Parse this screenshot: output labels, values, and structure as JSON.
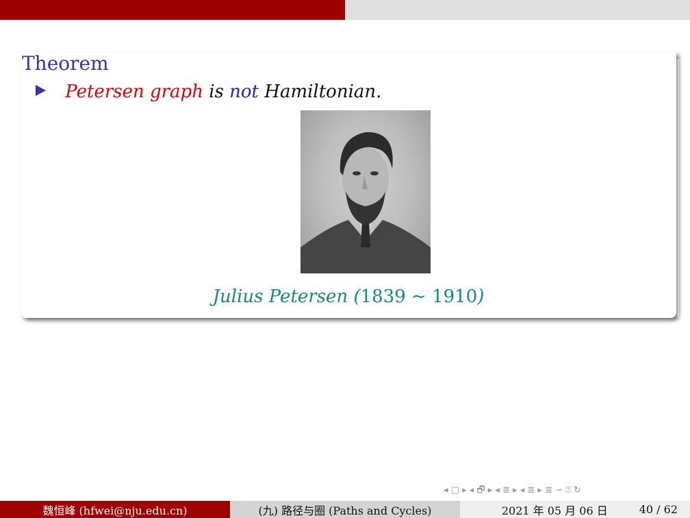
{
  "progress": {
    "fraction": 0.5
  },
  "theorem": {
    "title": "Theorem",
    "statement_parts": [
      "Petersen graph",
      " is ",
      "not",
      " Hamiltonian."
    ]
  },
  "figure": {
    "caption_name": "Julius Petersen (",
    "caption_years": "1839 ∼ 1910",
    "caption_close": ")"
  },
  "navigation": {
    "symbols": "◂ □ ▸ ◂ 🗗 ▸ ◂ ≣ ▸ ◂ ≣ ▸   ≣   ∽ ⍰ ↻"
  },
  "footer": {
    "author": "魏恒峰 (hfwei@nju.edu.cn)",
    "title": "(九) 路径与圈 (Paths and Cycles)",
    "date": "2021 年 05 月 06 日",
    "page": "40 / 62"
  }
}
